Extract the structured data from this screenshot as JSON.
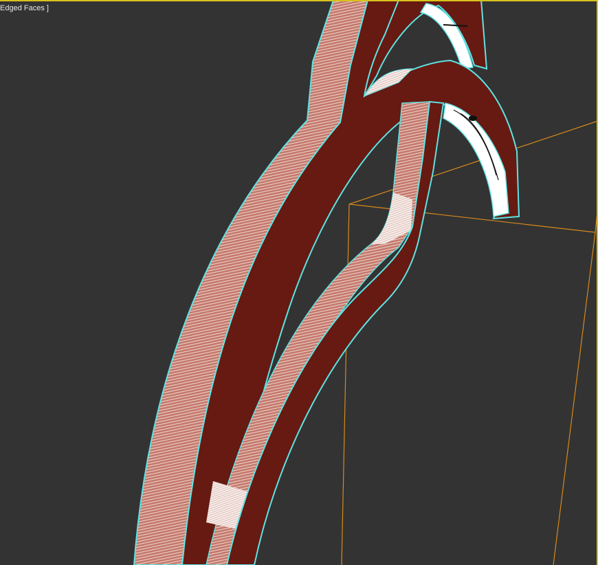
{
  "viewport": {
    "label": "Edged Faces ]",
    "label_color": "#e8e8e8",
    "background_color": "#333333",
    "active_border_color": "#d8c21a"
  },
  "scene": {
    "selection_outline_color": "#5fe3e3",
    "object_face_color": "#661a12",
    "object_side_color": "#c87a6e",
    "bounding_box_color": "#d88a1a"
  }
}
